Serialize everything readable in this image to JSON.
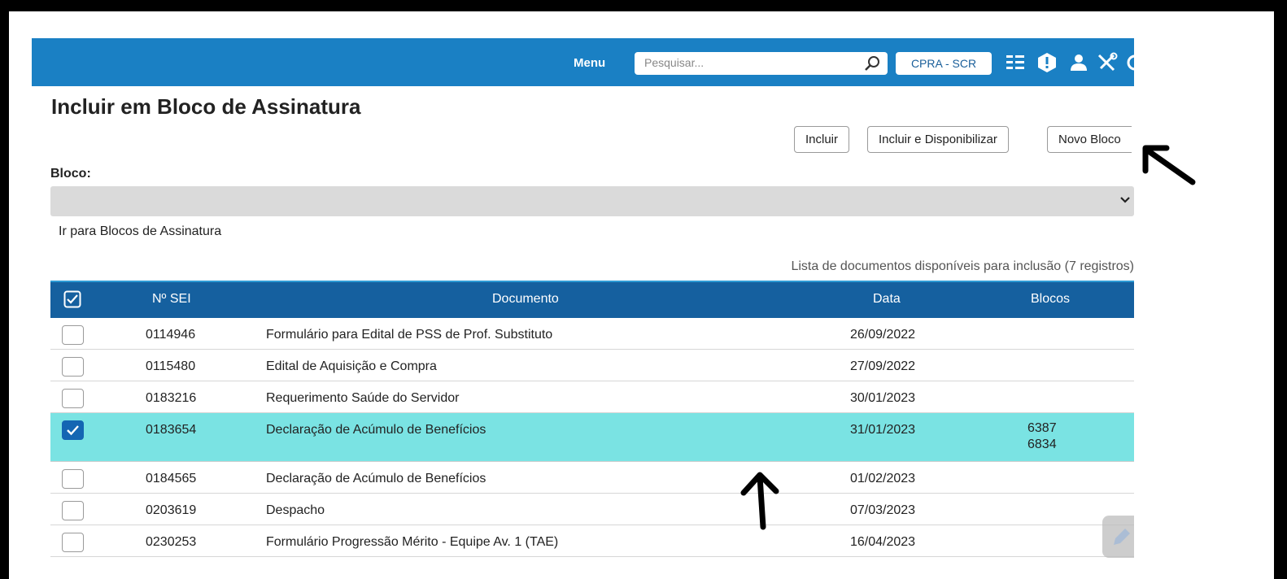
{
  "topbar": {
    "menu_label": "Menu",
    "search_placeholder": "Pesquisar...",
    "unit_label": "CPRA - SCR",
    "icons": [
      "list-icon",
      "alert-icon",
      "user-icon",
      "tools-icon"
    ]
  },
  "page": {
    "title": "Incluir em Bloco de Assinatura",
    "buttons": {
      "incluir": "Incluir",
      "incluir_disponibilizar": "Incluir e Disponibilizar",
      "novo_bloco": "Novo Bloco"
    },
    "bloco_label": "Bloco:",
    "bloco_value": "",
    "link": "Ir para Blocos de Assinatura",
    "table_caption": "Lista de documentos disponíveis para inclusão (7 registros)"
  },
  "table": {
    "headers": {
      "sei": "Nº SEI",
      "documento": "Documento",
      "data": "Data",
      "blocos": "Blocos"
    },
    "rows": [
      {
        "sei": "0114946",
        "documento": "Formulário para Edital de PSS de Prof. Substituto",
        "data": "26/09/2022",
        "blocos": [],
        "checked": false
      },
      {
        "sei": "0115480",
        "documento": "Edital de Aquisição e Compra",
        "data": "27/09/2022",
        "blocos": [],
        "checked": false
      },
      {
        "sei": "0183216",
        "documento": "Requerimento Saúde do Servidor",
        "data": "30/01/2023",
        "blocos": [],
        "checked": false
      },
      {
        "sei": "0183654",
        "documento": "Declaração de Acúmulo de Benefícios",
        "data": "31/01/2023",
        "blocos": [
          "6387",
          "6834"
        ],
        "checked": true
      },
      {
        "sei": "0184565",
        "documento": "Declaração de Acúmulo de Benefícios",
        "data": "01/02/2023",
        "blocos": [],
        "checked": false
      },
      {
        "sei": "0203619",
        "documento": "Despacho",
        "data": "07/03/2023",
        "blocos": [],
        "checked": false
      },
      {
        "sei": "0230253",
        "documento": "Formulário Progressão Mérito - Equipe Av. 1 (TAE)",
        "data": "16/04/2023",
        "blocos": [],
        "checked": false
      }
    ]
  },
  "colors": {
    "topbar": "#1a80c4",
    "table_header": "#15609f",
    "selected_row": "#7ae3e3",
    "checkbox_checked": "#1466b3"
  }
}
